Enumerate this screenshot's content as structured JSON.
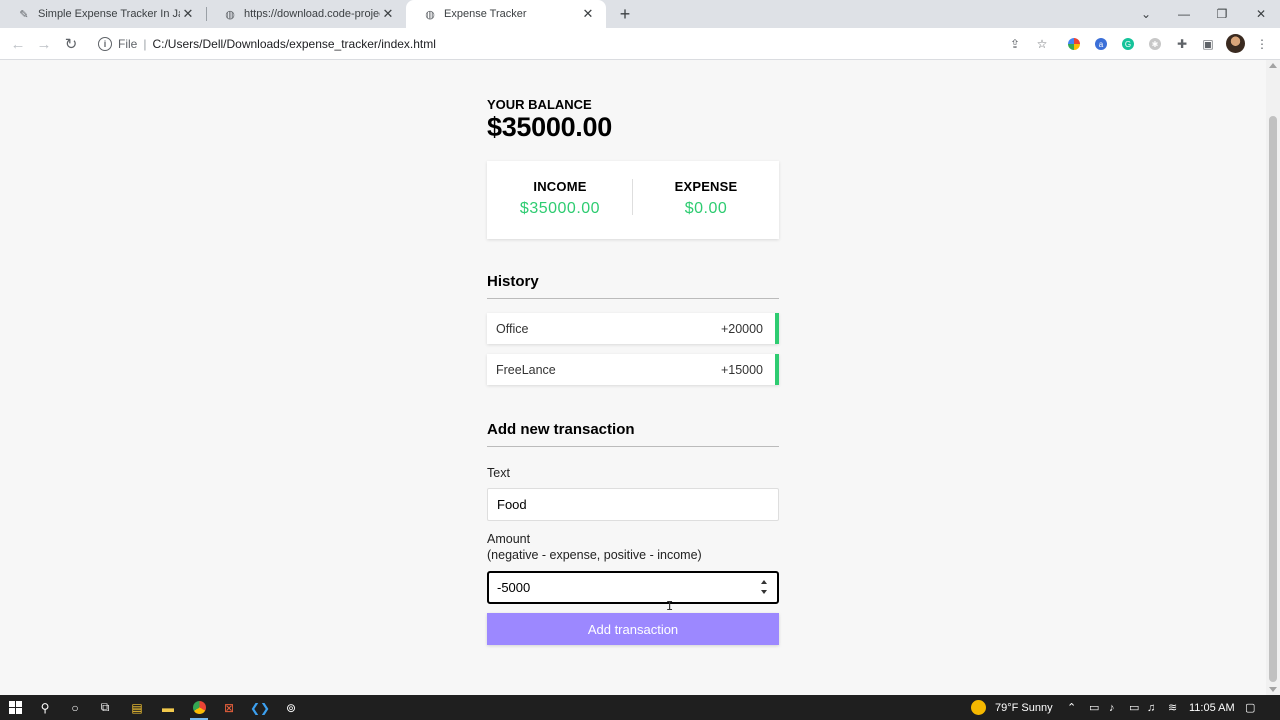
{
  "browser": {
    "tabs": [
      {
        "title": "Simple Expense Tracker In JavaSc",
        "favicon": "code-projects-icon",
        "active": false
      },
      {
        "title": "https://download.code-projects.o",
        "favicon": "globe-icon",
        "active": false
      },
      {
        "title": "Expense Tracker",
        "favicon": "globe-icon",
        "active": true
      }
    ],
    "address": {
      "scheme": "File",
      "url": "C:/Users/Dell/Downloads/expense_tracker/index.html"
    }
  },
  "page": {
    "balance_label": "YOUR BALANCE",
    "balance": "$35000.00",
    "income_label": "INCOME",
    "income": "$35000.00",
    "expense_label": "EXPENSE",
    "expense": "$0.00",
    "history_title": "History",
    "history": [
      {
        "text": "Office",
        "amount": "+20000"
      },
      {
        "text": "FreeLance",
        "amount": "+15000"
      }
    ],
    "add_title": "Add new transaction",
    "text_label": "Text",
    "text_value": "Food",
    "amount_label": "Amount",
    "amount_hint": "(negative - expense, positive - income)",
    "amount_value": "-5000",
    "button_label": "Add transaction"
  },
  "colors": {
    "income": "#2ecc71",
    "button": "#9c88ff"
  },
  "taskbar": {
    "weather": "79°F  Sunny",
    "time": "11:05 AM"
  }
}
